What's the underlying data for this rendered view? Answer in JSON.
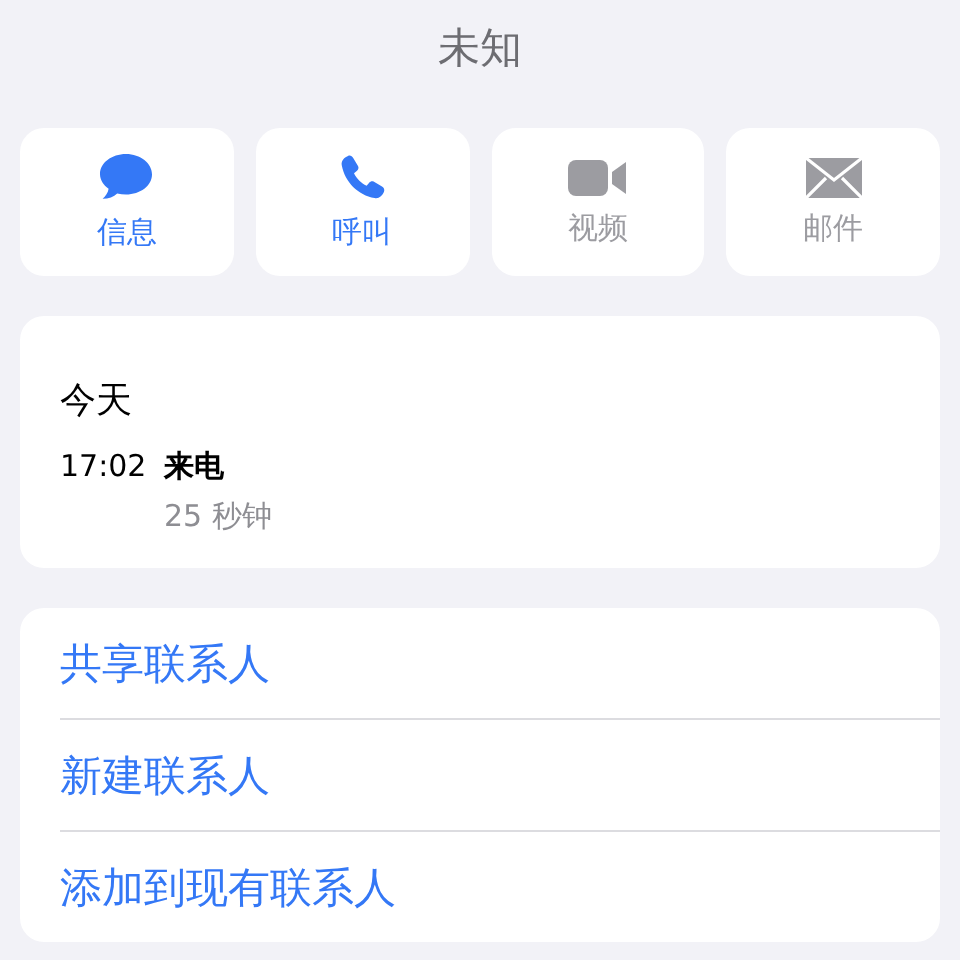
{
  "subtitle": "未知",
  "actions": [
    {
      "label": "信息",
      "kind": "message",
      "disabled": false
    },
    {
      "label": "呼叫",
      "kind": "phone",
      "disabled": false
    },
    {
      "label": "视频",
      "kind": "video",
      "disabled": true
    },
    {
      "label": "邮件",
      "kind": "mail",
      "disabled": true
    }
  ],
  "history": {
    "day": "今天",
    "entries": [
      {
        "time": "17:02",
        "type": "来电",
        "duration": "25 秒钟"
      }
    ]
  },
  "links": [
    "共享联系人",
    "新建联系人",
    "添加到现有联系人"
  ]
}
